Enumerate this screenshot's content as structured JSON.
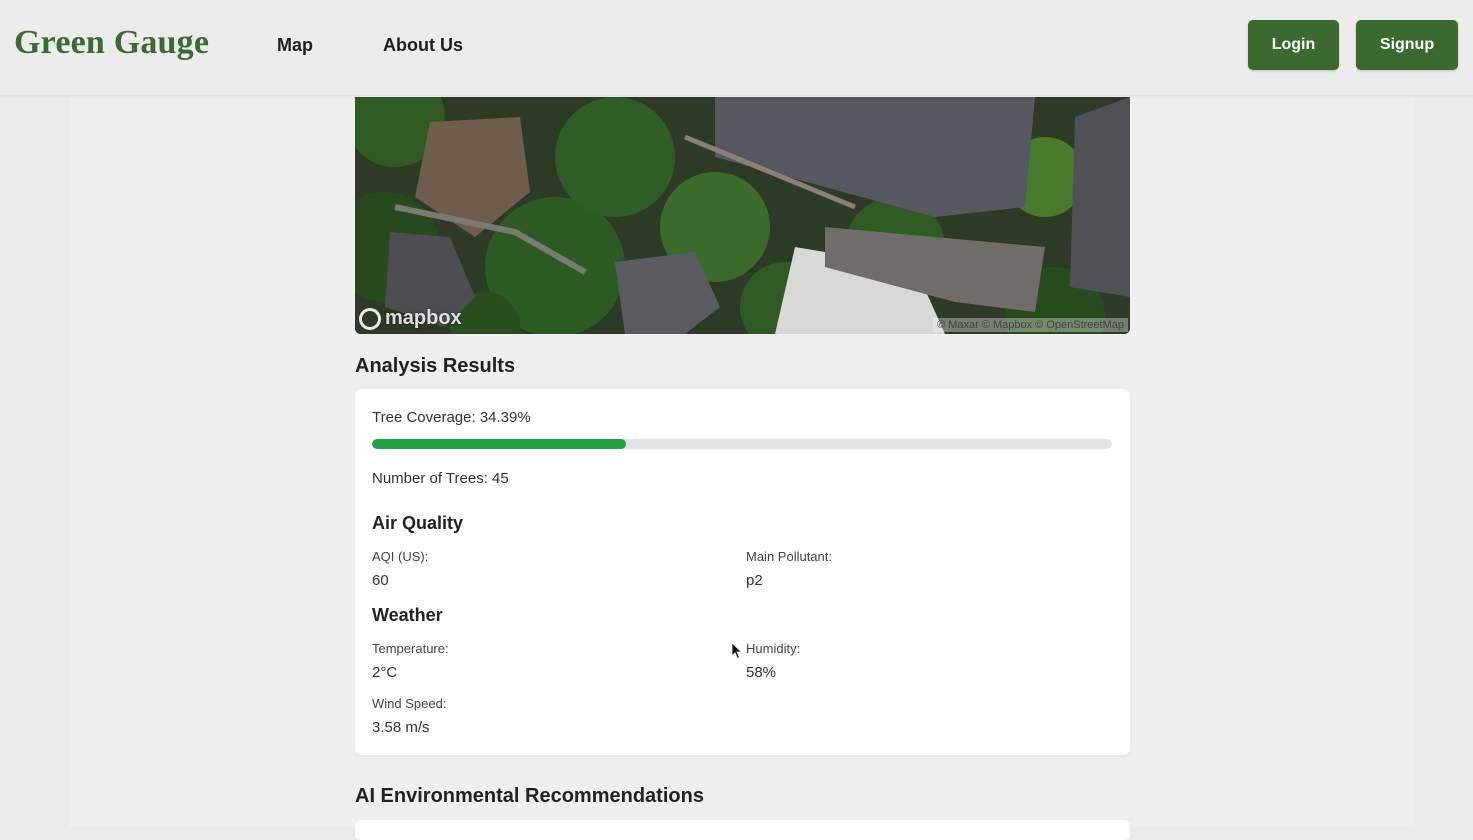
{
  "nav": {
    "brand": "Green Gauge",
    "links": [
      "Map",
      "About Us"
    ],
    "login": "Login",
    "signup": "Signup"
  },
  "map": {
    "logo_text": "mapbox",
    "attribution": "© Maxar © Mapbox © OpenStreetMap"
  },
  "analysis": {
    "title": "Analysis Results",
    "tree_coverage_text": "Tree Coverage: 34.39%",
    "tree_coverage_percent": 34.39,
    "trees_text": "Number of Trees: 45",
    "air_quality": {
      "title": "Air Quality",
      "aqi_label": "AQI (US):",
      "aqi_value": "60",
      "pollutant_label": "Main Pollutant:",
      "pollutant_value": "p2"
    },
    "weather": {
      "title": "Weather",
      "temperature_label": "Temperature:",
      "temperature_value": "2°C",
      "humidity_label": "Humidity:",
      "humidity_value": "58%",
      "wind_label": "Wind Speed:",
      "wind_value": "3.58 m/s"
    }
  },
  "ai_section": {
    "title": "AI Environmental Recommendations"
  },
  "colors": {
    "brand": "#3e6b32",
    "button": "#3a6a2e",
    "progress": "#22a23f"
  }
}
